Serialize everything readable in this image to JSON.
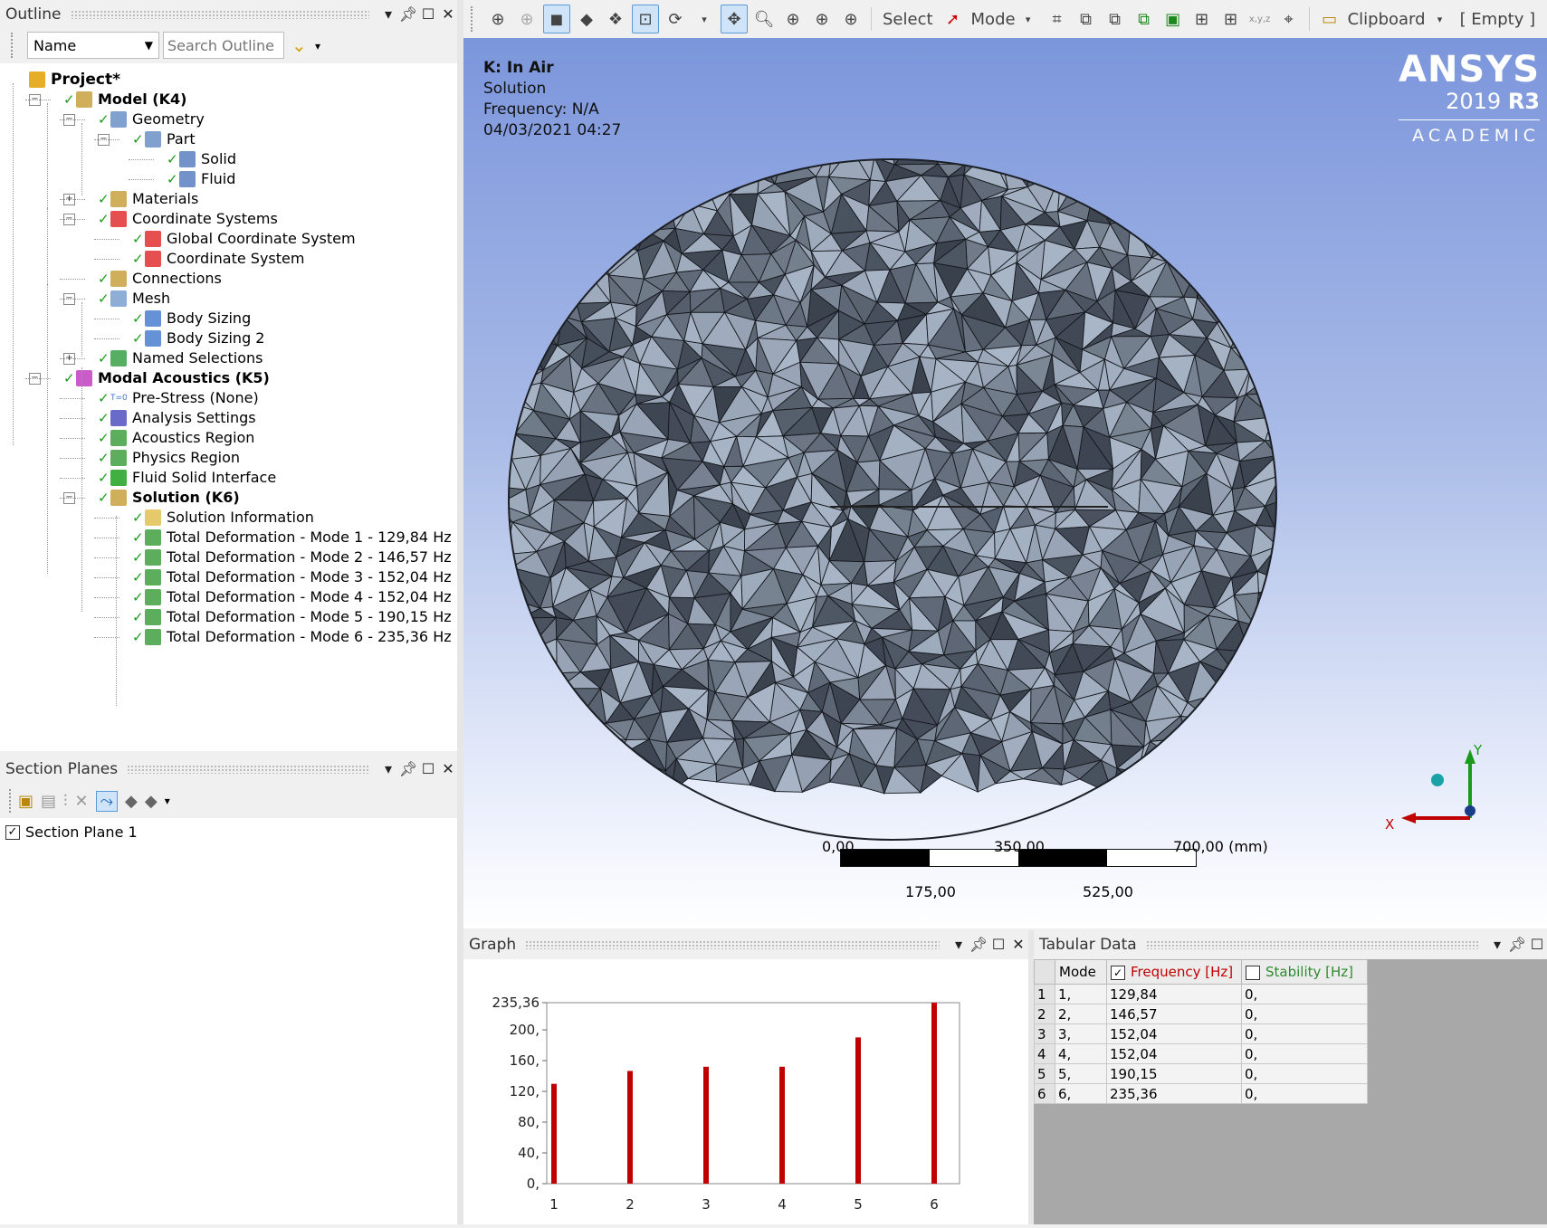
{
  "outline": {
    "title": "Outline",
    "filter_label": "Name",
    "search_placeholder": "Search Outline",
    "tree": [
      {
        "label": "Project*",
        "bold": true
      },
      {
        "label": "Model (K4)",
        "bold": true
      },
      {
        "label": "Geometry"
      },
      {
        "label": "Part"
      },
      {
        "label": "Solid"
      },
      {
        "label": "Fluid"
      },
      {
        "label": "Materials"
      },
      {
        "label": "Coordinate Systems"
      },
      {
        "label": "Global Coordinate System"
      },
      {
        "label": "Coordinate System"
      },
      {
        "label": "Connections"
      },
      {
        "label": "Mesh"
      },
      {
        "label": "Body Sizing"
      },
      {
        "label": "Body Sizing 2"
      },
      {
        "label": "Named Selections"
      },
      {
        "label": "Modal Acoustics (K5)",
        "bold": true
      },
      {
        "label": "Pre-Stress (None)",
        "icon_text": "T=0"
      },
      {
        "label": "Analysis Settings"
      },
      {
        "label": "Acoustics Region"
      },
      {
        "label": "Physics Region"
      },
      {
        "label": "Fluid Solid Interface"
      },
      {
        "label": "Solution (K6)",
        "bold": true
      },
      {
        "label": "Solution Information"
      },
      {
        "label": "Total Deformation - Mode 1 - 129,84 Hz"
      },
      {
        "label": "Total Deformation - Mode 2 - 146,57 Hz"
      },
      {
        "label": "Total Deformation - Mode 3 - 152,04 Hz"
      },
      {
        "label": "Total Deformation - Mode 4 - 152,04 Hz"
      },
      {
        "label": "Total Deformation - Mode 5 - 190,15 Hz"
      },
      {
        "label": "Total Deformation - Mode 6 - 235,36 Hz"
      }
    ]
  },
  "section_planes": {
    "title": "Section Planes",
    "items": [
      {
        "label": "Section Plane 1",
        "checked": true
      }
    ]
  },
  "toolbar": {
    "select_label": "Select",
    "mode_label": "Mode",
    "clipboard_label": "Clipboard",
    "empty_label": "[ Empty ]",
    "axes_tiny": "x,y,z"
  },
  "viewport": {
    "analysis_name": "K: In Air",
    "result_type": "Solution",
    "frequency": "Frequency: N/A",
    "datetime": "04/03/2021 04:27",
    "brand": "ANSYS",
    "version_year": "2019",
    "version_release": "R3",
    "edition": "ACADEMIC",
    "scale_top": [
      "0,00",
      "350,00",
      "700,00 (mm)"
    ],
    "scale_bottom": [
      "175,00",
      "525,00"
    ],
    "axis_x": "X",
    "axis_y": "Y"
  },
  "graph": {
    "title": "Graph"
  },
  "tabular": {
    "title": "Tabular Data",
    "headers": {
      "mode": "Mode",
      "frequency": "Frequency [Hz]",
      "stability": "Stability [Hz]"
    },
    "frequency_checked": true,
    "stability_checked": false,
    "rows": [
      {
        "n": "1",
        "mode": "1,",
        "freq": "129,84",
        "stab": "0,"
      },
      {
        "n": "2",
        "mode": "2,",
        "freq": "146,57",
        "stab": "0,"
      },
      {
        "n": "3",
        "mode": "3,",
        "freq": "152,04",
        "stab": "0,"
      },
      {
        "n": "4",
        "mode": "4,",
        "freq": "152,04",
        "stab": "0,"
      },
      {
        "n": "5",
        "mode": "5,",
        "freq": "190,15",
        "stab": "0,"
      },
      {
        "n": "6",
        "mode": "6,",
        "freq": "235,36",
        "stab": "0,"
      }
    ]
  },
  "colors": {
    "bar": "#c00000",
    "frequency_header": "#c00000",
    "stability_header": "#2e8b2e",
    "mesh_light": "#a9b6c8",
    "mesh_dark": "#39414d"
  },
  "chart_data": {
    "type": "bar",
    "categories": [
      "1",
      "2",
      "3",
      "4",
      "5",
      "6"
    ],
    "values": [
      129.84,
      146.57,
      152.04,
      152.04,
      190.15,
      235.36
    ],
    "y_ticks": [
      "0,",
      "40,",
      "80,",
      "120,",
      "160,",
      "200,",
      "235,36"
    ],
    "y_tick_values": [
      0,
      40,
      80,
      120,
      160,
      200,
      235.36
    ],
    "ylim": [
      0,
      235.36
    ],
    "title": "",
    "xlabel": "",
    "ylabel": ""
  }
}
